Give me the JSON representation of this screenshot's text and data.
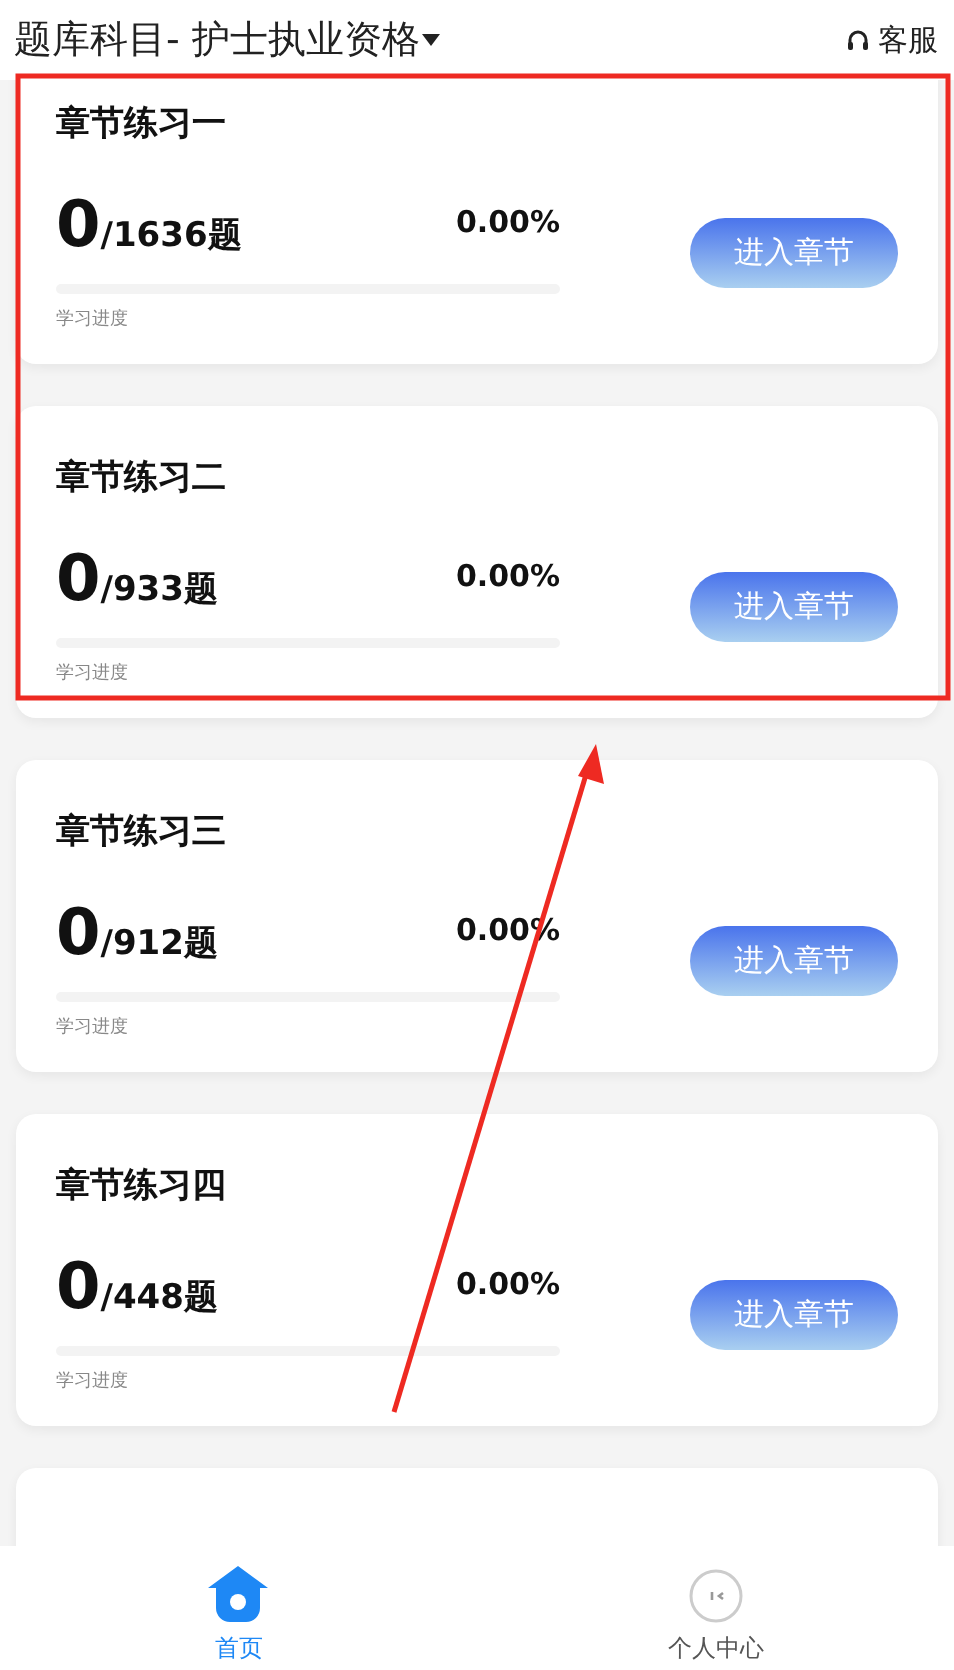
{
  "header": {
    "title": "题库科目- 护士执业资格",
    "service": "客服"
  },
  "chapters": [
    {
      "title": "章节练习一",
      "done": "0",
      "total": "/1636题",
      "percent": "0.00%",
      "level": 0,
      "progress_label": "学习进度",
      "button": "进入章节"
    },
    {
      "title": "章节练习二",
      "done": "0",
      "total": "/933题",
      "percent": "0.00%",
      "level": 0,
      "progress_label": "学习进度",
      "button": "进入章节"
    },
    {
      "title": "章节练习三",
      "done": "0",
      "total": "/912题",
      "percent": "0.00%",
      "level": 0,
      "progress_label": "学习进度",
      "button": "进入章节"
    },
    {
      "title": "章节练习四",
      "done": "0",
      "total": "/448题",
      "percent": "0.00%",
      "level": 0,
      "progress_label": "学习进度",
      "button": "进入章节"
    }
  ],
  "tab_bar": [
    {
      "label": "首页",
      "kind": "home",
      "selected": true
    },
    {
      "label": "个人中心",
      "kind": "profile",
      "selected": false
    }
  ]
}
